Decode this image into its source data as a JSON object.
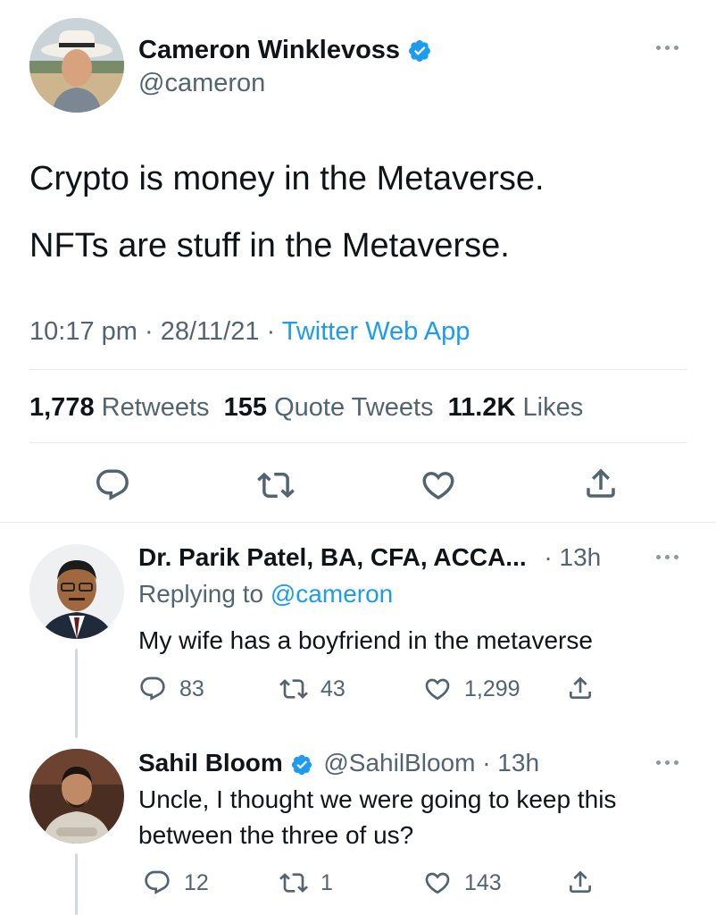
{
  "main_tweet": {
    "author_name": "Cameron Winklevoss",
    "handle": "@cameron",
    "line1": "Crypto is money in the Metaverse.",
    "line2": "NFTs are stuff in the Metaverse.",
    "time": "10:17 pm",
    "date": "28/11/21",
    "source": "Twitter Web App",
    "separator": "·",
    "retweets_count": "1,778",
    "retweets_label": "Retweets",
    "quotes_count": "155",
    "quotes_label": "Quote Tweets",
    "likes_count": "11.2K",
    "likes_label": "Likes"
  },
  "reply1": {
    "author_name": "Dr. Parik Patel, BA, CFA, ACCA...",
    "age": "· 13h",
    "replying_prefix": "Replying to",
    "replying_handle": "@cameron",
    "text": "My wife has a boyfriend in the metaverse",
    "replies": "83",
    "retweets": "43",
    "likes": "1,299"
  },
  "reply2": {
    "author_name": "Sahil Bloom",
    "handle": "@SahilBloom",
    "age": "· 13h",
    "line1": "Uncle, I thought we were going to keep this",
    "line2": "between the three of us?",
    "replies": "12",
    "retweets": "1",
    "likes": "143"
  },
  "icons": {
    "reply": "reply-icon",
    "retweet": "retweet-icon",
    "like": "heart-icon",
    "share": "share-icon",
    "more": "more-icon",
    "verified": "verified-badge-icon"
  },
  "colors": {
    "accent": "#1d9bf0",
    "text": "#0f1419",
    "secondary": "#536471",
    "divider": "#e6e9eb"
  }
}
